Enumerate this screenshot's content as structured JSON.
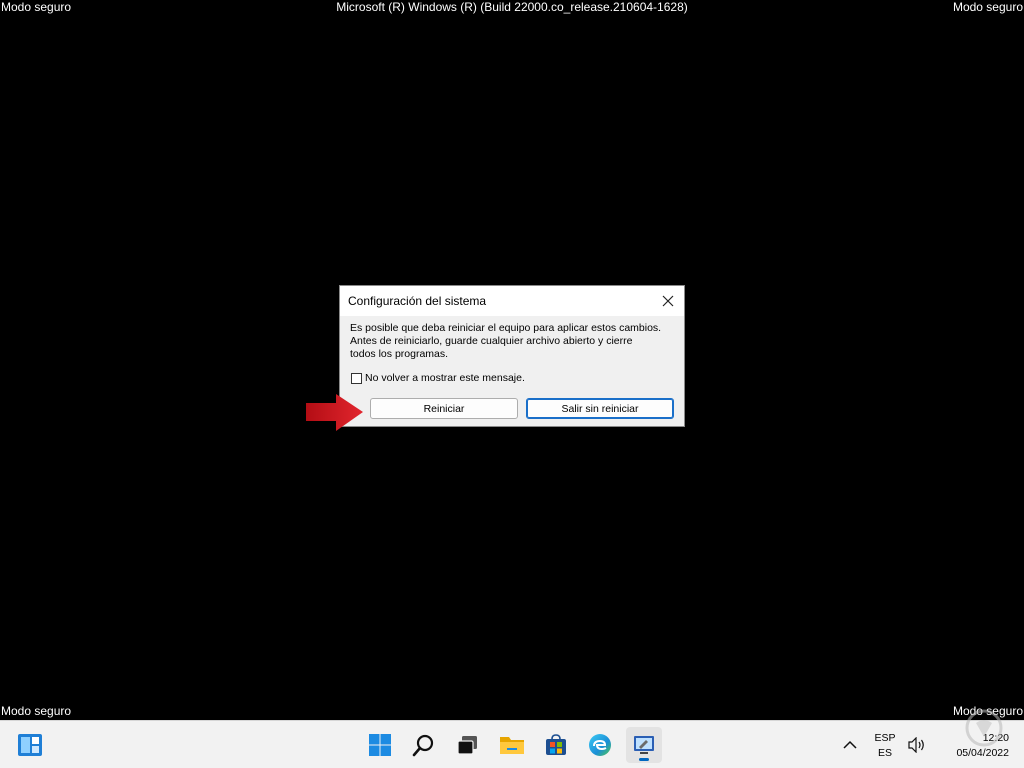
{
  "watermarks": {
    "top_left": "Modo seguro",
    "top_center": "Microsoft (R) Windows (R) (Build 22000.co_release.210604-1628)",
    "top_right": "Modo seguro",
    "bottom_left": "Modo seguro",
    "bottom_right": "Modo seguro"
  },
  "dialog": {
    "title": "Configuración del sistema",
    "message_lines": [
      "Es posible que deba reiniciar el equipo para aplicar estos cambios.",
      "Antes de reiniciarlo, guarde cualquier archivo abierto y cierre",
      "todos los programas."
    ],
    "checkbox_label": "No volver a mostrar este mensaje.",
    "checkbox_checked": false,
    "restart_label": "Reiniciar",
    "exit_label": "Salir sin reiniciar"
  },
  "annotation": {
    "arrow_color": "#c8101a"
  },
  "taskbar": {
    "icons": [
      "widgets-icon",
      "start-icon",
      "search-icon",
      "task-view-icon",
      "file-explorer-icon",
      "store-icon",
      "edge-icon",
      "system-config-icon"
    ],
    "language_top": "ESP",
    "language_bottom": "ES",
    "time": "12:20",
    "date": "05/04/2022"
  },
  "colors": {
    "accent": "#0067c0",
    "desktop_background": "#000000",
    "taskbar_background": "#f2f2f2",
    "dialog_background": "#f0f0f0"
  }
}
